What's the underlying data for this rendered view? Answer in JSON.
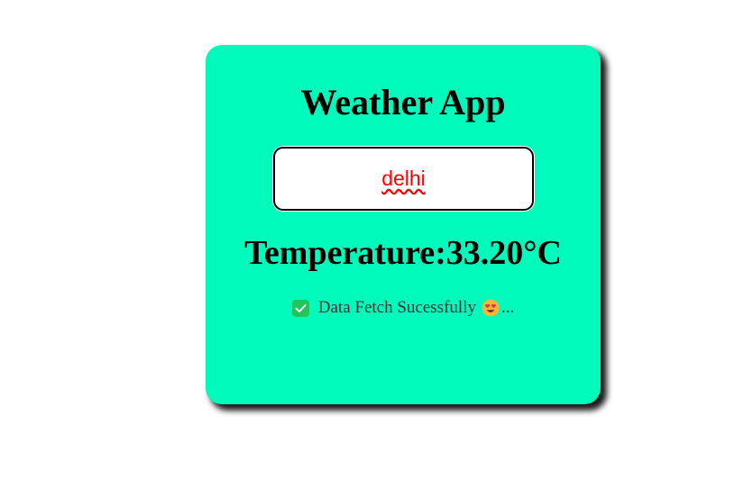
{
  "app": {
    "title": "Weather App"
  },
  "search": {
    "value": "delhi"
  },
  "weather": {
    "temperature_text": "Temperature:33.20°C"
  },
  "status": {
    "message": "Data Fetch Sucessfully",
    "suffix": "...",
    "check_icon": "check-box-icon",
    "emoji_icon": "heart-eyes-emoji-icon"
  },
  "colors": {
    "card_background": "#00fabc",
    "input_text": "#ff0000",
    "check_green": "#21c45d"
  }
}
